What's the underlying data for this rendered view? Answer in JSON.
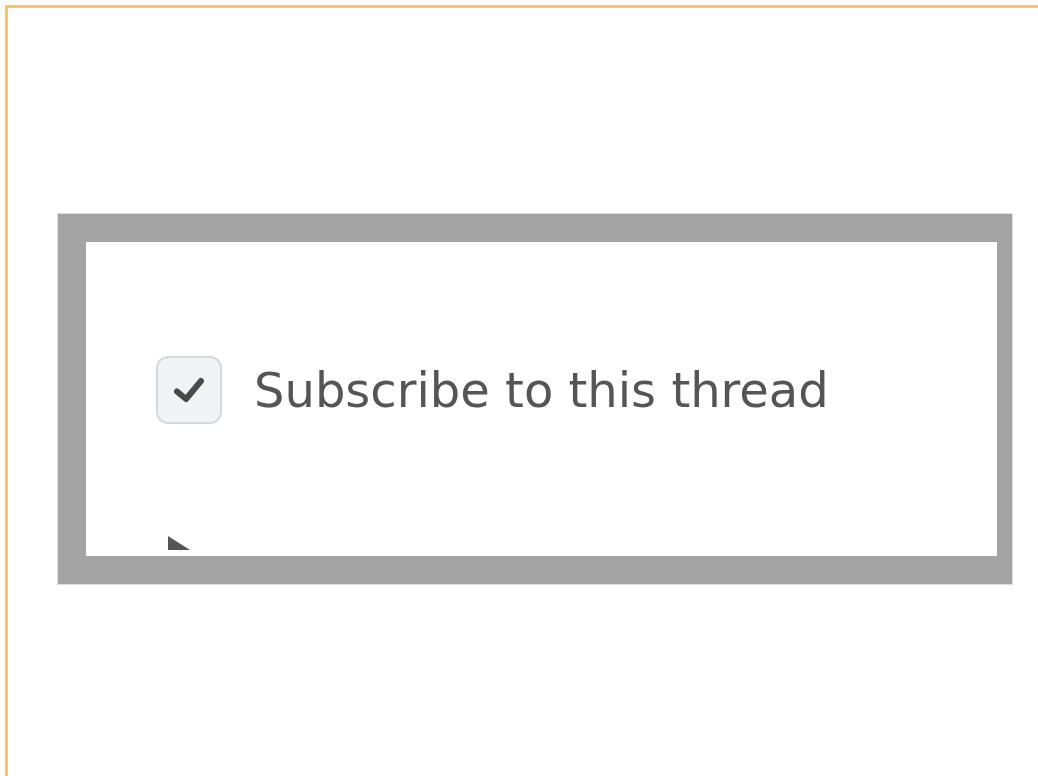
{
  "subscribe": {
    "label": "Subscribe to this thread",
    "checked": true
  }
}
